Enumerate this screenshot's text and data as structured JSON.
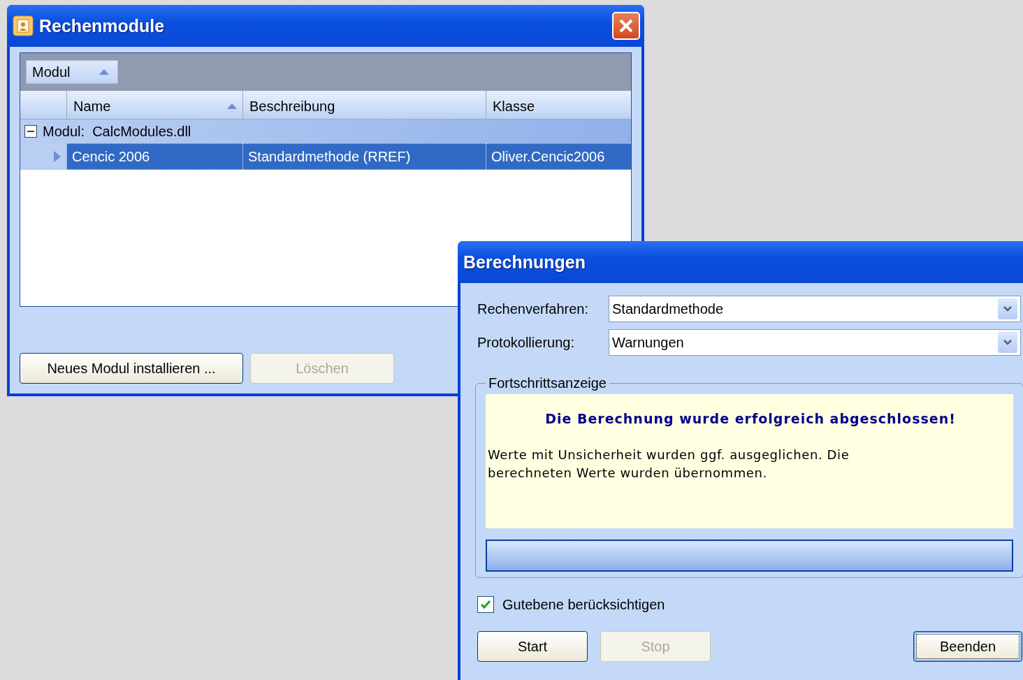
{
  "modules_window": {
    "title": "Rechenmodule",
    "group_by": {
      "label": "Modul",
      "sorted": true
    },
    "columns": [
      {
        "label": "Name",
        "sorted": true
      },
      {
        "label": "Beschreibung",
        "sorted": false
      },
      {
        "label": "Klasse",
        "sorted": false
      }
    ],
    "groups": [
      {
        "label": "Modul:  CalcModules.dll",
        "expanded": true,
        "rows": [
          {
            "selected": true,
            "cells": [
              "Cencic 2006",
              "Standardmethode (RREF)",
              "Oliver.Cencic2006"
            ]
          }
        ]
      }
    ],
    "buttons": [
      {
        "label": "Neues Modul installieren ...",
        "disabled": false
      },
      {
        "label": "Löschen",
        "disabled": true
      }
    ]
  },
  "calc_window": {
    "title": "Berechnungen",
    "fields": [
      {
        "label": "Rechenverfahren:",
        "value": "Standardmethode"
      },
      {
        "label": "Protokollierung:",
        "value": "Warnungen"
      }
    ],
    "progress": {
      "title": "Fortschrittsanzeige",
      "headline": "Die Berechnung wurde erfolgreich abgeschlossen!",
      "message": "Werte mit Unsicherheit wurden ggf. ausgeglichen. Die berechneten Werte wurden übernommen.",
      "level": 1
    },
    "option": {
      "label": "Gutebene berücksichtigen",
      "checked": true
    },
    "buttons": [
      {
        "label": "Start",
        "disabled": false,
        "focused": false
      },
      {
        "label": "Stop",
        "disabled": true,
        "focused": false
      },
      {
        "label": "Beenden",
        "disabled": false,
        "focused": true
      }
    ]
  }
}
